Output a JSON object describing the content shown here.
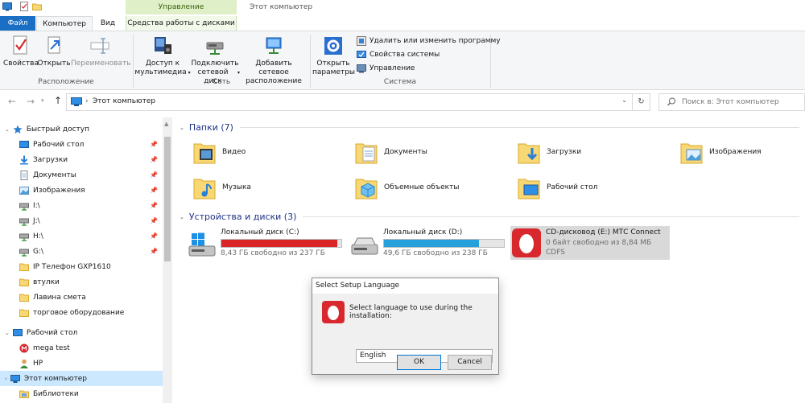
{
  "tabs": {
    "file": "Файл",
    "computer": "Компьютер",
    "view": "Вид",
    "disk_tools": "Средства работы с дисками",
    "manage": "Управление",
    "window_title": "Этот компьютер"
  },
  "ribbon": {
    "location": {
      "label": "Расположение",
      "properties": "Свойства",
      "open": "Открыть",
      "rename": "Переименовать"
    },
    "network": {
      "label": "Сеть",
      "media_line1": "Доступ к",
      "media_line2": "мультимедиа",
      "map_line1": "Подключить",
      "map_line2": "сетевой диск",
      "add_line1": "Добавить сетевое",
      "add_line2": "расположение"
    },
    "system": {
      "label": "Система",
      "open_line1": "Открыть",
      "open_line2": "параметры",
      "uninstall": "Удалить или изменить программу",
      "sysprops": "Свойства системы",
      "manage": "Управление"
    }
  },
  "address": {
    "breadcrumb": "Этот компьютер",
    "search_placeholder": "Поиск в: Этот компьютер"
  },
  "sidebar": {
    "quick_access": "Быстрый доступ",
    "items": [
      {
        "label": "Рабочий стол",
        "pinned": true
      },
      {
        "label": "Загрузки",
        "pinned": true
      },
      {
        "label": "Документы",
        "pinned": true
      },
      {
        "label": "Изображения",
        "pinned": true
      },
      {
        "label": "I:\\",
        "pinned": true
      },
      {
        "label": "J:\\",
        "pinned": true
      },
      {
        "label": "H:\\",
        "pinned": true
      },
      {
        "label": "G:\\",
        "pinned": true
      },
      {
        "label": "IP Телефон GXP1610",
        "pinned": false
      },
      {
        "label": "втулки",
        "pinned": false
      },
      {
        "label": "Лавина смета",
        "pinned": false
      },
      {
        "label": "торговое оборудование",
        "pinned": false
      }
    ],
    "desktop": "Рабочий стол",
    "desktop_items": [
      "mega test",
      "HP",
      "Этот компьютер",
      "Библиотеки"
    ]
  },
  "content": {
    "folders_title": "Папки (7)",
    "folders": [
      "Видео",
      "Документы",
      "Загрузки",
      "Изображения",
      "Музыка",
      "Объемные объекты",
      "Рабочий стол"
    ],
    "drives_title": "Устройства и диски (3)",
    "drives": [
      {
        "name": "Локальный диск (C:)",
        "free": "8,43 ГБ свободно из 237 ГБ",
        "used_fraction": 0.964,
        "color": "#da2626"
      },
      {
        "name": "Локальный диск (D:)",
        "free": "49,6 ГБ свободно из 238 ГБ",
        "used_fraction": 0.79,
        "color": "#26a0da"
      },
      {
        "name": "CD-дисковод (E:) МТС Connect",
        "free": "0 байт свободно из 8,84 МБ",
        "fs": "CDFS"
      }
    ]
  },
  "dialog": {
    "title": "Select Setup Language",
    "prompt": "Select language to use during the installation:",
    "language": "English",
    "ok": "OK",
    "cancel": "Cancel"
  }
}
